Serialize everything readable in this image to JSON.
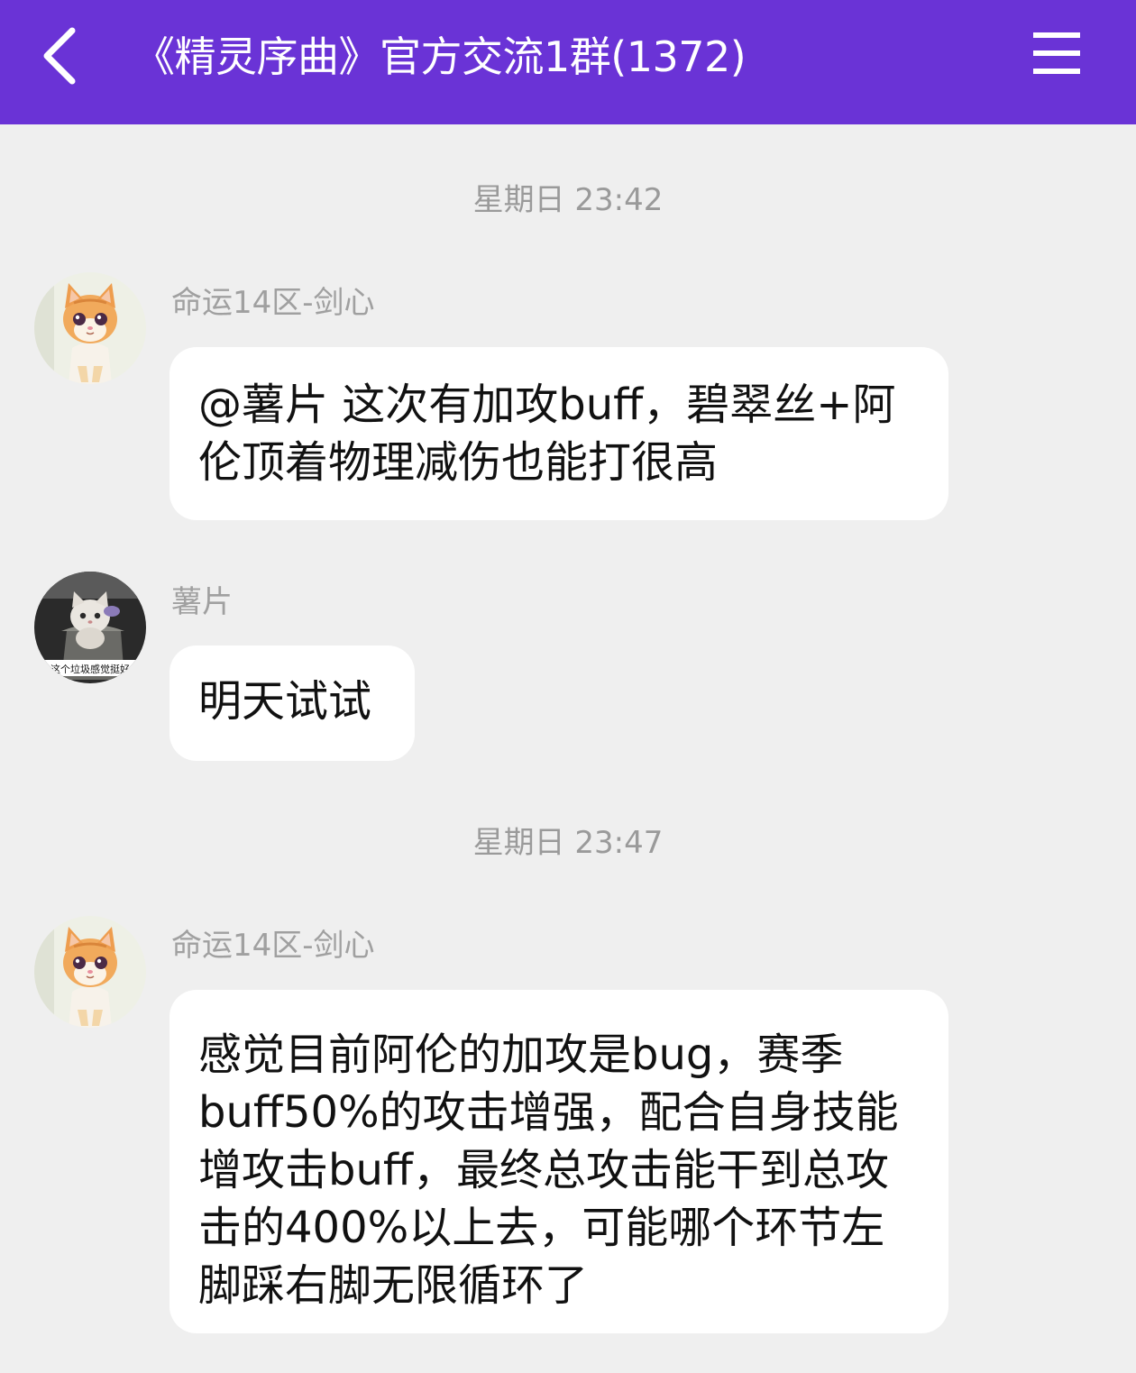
{
  "header": {
    "title": "《精灵序曲》官方交流1群(1372)",
    "back_icon": "chevron-left-icon",
    "menu_icon": "hamburger-menu-icon"
  },
  "colors": {
    "header_bg": "#6a33d6",
    "chat_bg": "#efefef",
    "bubble_bg": "#ffffff",
    "timestamp_text": "#9a9a9a",
    "sender_text": "#a0a0a0"
  },
  "messages": [
    {
      "timestamp": "星期日 23:42",
      "sender": "命运14区-剑心",
      "avatar": "orange-kitten-avatar",
      "text": "@薯片 这次有加攻buff，碧翠丝+阿伦顶着物理减伤也能打很高"
    },
    {
      "sender": "薯片",
      "avatar": "cat-in-trash-can-avatar",
      "avatar_caption": "这个垃圾感觉挺好",
      "text": "明天试试"
    },
    {
      "timestamp": "星期日 23:47",
      "sender": "命运14区-剑心",
      "avatar": "orange-kitten-avatar",
      "text": "感觉目前阿伦的加攻是bug，赛季buff50%的攻击增强，配合自身技能增攻击buff，最终总攻击能干到总攻击的400%以上去，可能哪个环节左脚踩右脚无限循环了"
    }
  ]
}
